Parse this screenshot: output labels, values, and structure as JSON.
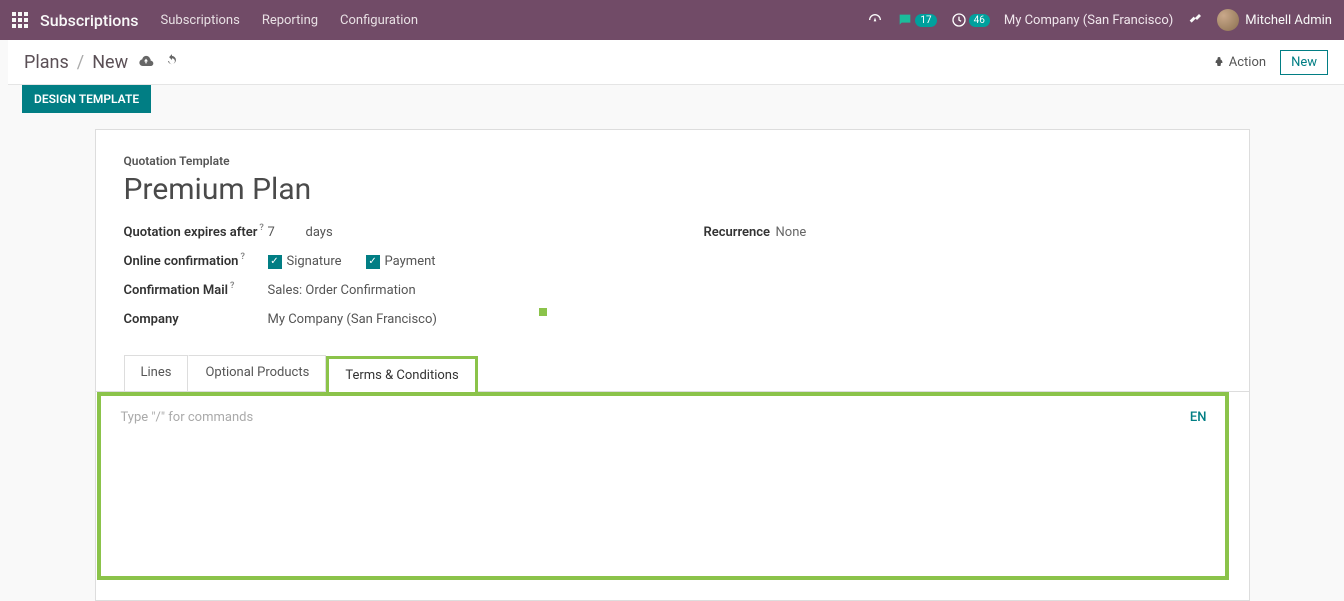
{
  "topbar": {
    "app_title": "Subscriptions",
    "nav": [
      "Subscriptions",
      "Reporting",
      "Configuration"
    ],
    "messages_count": "17",
    "activities_count": "46",
    "company": "My Company (San Francisco)",
    "user": "Mitchell Admin"
  },
  "breadcrumb": {
    "root": "Plans",
    "current": "New"
  },
  "controls": {
    "action_label": "Action",
    "new_label": "New",
    "design_template_label": "DESIGN TEMPLATE"
  },
  "form": {
    "subtitle": "Quotation Template",
    "title": "Premium Plan",
    "labels": {
      "expires": "Quotation expires after",
      "online_conf": "Online confirmation",
      "conf_mail": "Confirmation Mail",
      "company": "Company",
      "recurrence": "Recurrence"
    },
    "expires_value": "7",
    "expires_unit": "days",
    "signature_label": "Signature",
    "payment_label": "Payment",
    "conf_mail_value": "Sales: Order Confirmation",
    "company_value": "My Company (San Francisco)",
    "recurrence_value": "None"
  },
  "tabs": {
    "lines": "Lines",
    "optional": "Optional Products",
    "terms": "Terms & Conditions"
  },
  "editor": {
    "placeholder": "Type \"/\" for commands",
    "lang": "EN"
  }
}
